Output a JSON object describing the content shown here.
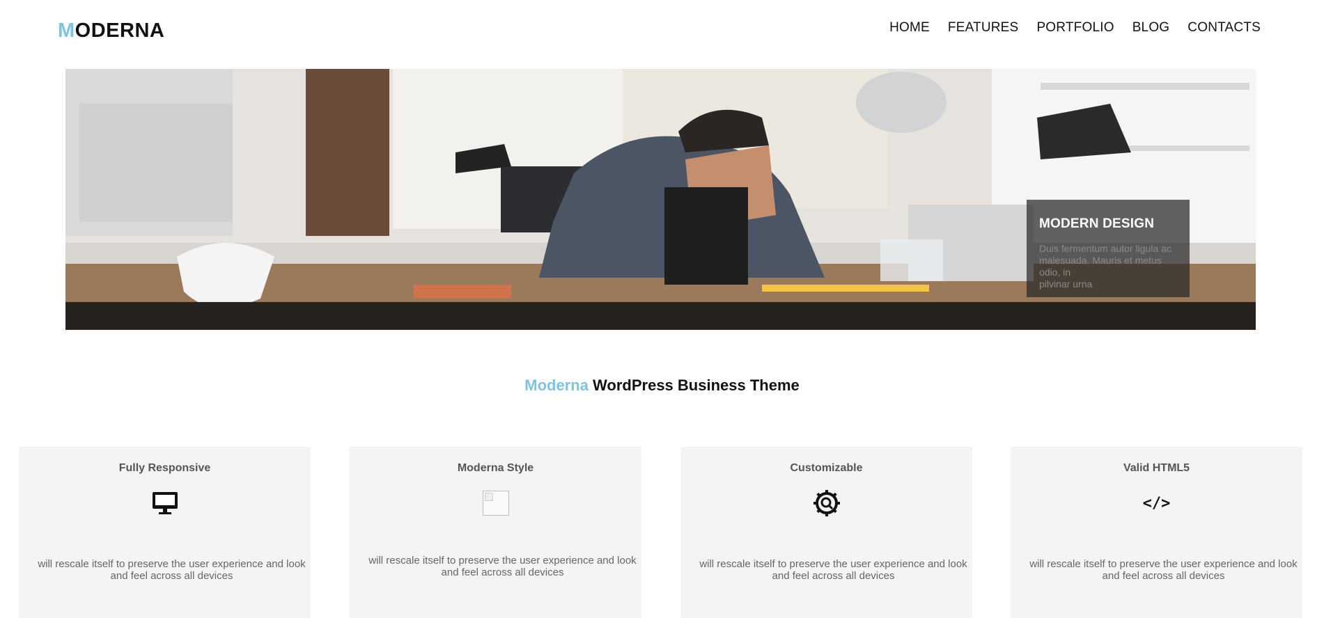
{
  "header": {
    "logo_accent": "M",
    "logo_rest": "ODERNA",
    "nav": [
      "HOME",
      "FEATURES",
      "PORTFOLIO",
      "BLOG",
      "CONTACTS"
    ]
  },
  "hero": {
    "caption_title": "MODERN DESIGN",
    "caption_line1": "Duis fermentum autor ligula ac",
    "caption_line2": "malesuada. Mauris et metus",
    "caption_line3": "odio, in",
    "caption_line4": "pilvinar urna"
  },
  "section": {
    "title_accent": "Moderna",
    "title_rest": " WordPress Business Theme"
  },
  "features": [
    {
      "title": "Fully Responsive",
      "icon": "monitor-icon",
      "line1": "will rescale itself to preserve the user experience and look",
      "line2": "and feel across all devices"
    },
    {
      "title": "Moderna Style",
      "icon": "broken-image-icon",
      "line1": "will rescale itself to preserve the user experience and look",
      "line2": "and feel across all devices"
    },
    {
      "title": "Customizable",
      "icon": "gear-search-icon",
      "line1": "will rescale itself to preserve the user experience and look",
      "line2": "and feel across all devices"
    },
    {
      "title": "Valid HTML5",
      "icon": "code-icon",
      "icon_text": "</>",
      "line1": "will rescale itself to preserve the user experience and look",
      "line2": "and feel across all devices"
    }
  ],
  "colors": {
    "accent": "#7cc4e0",
    "card_bg": "#f4f4f4"
  }
}
